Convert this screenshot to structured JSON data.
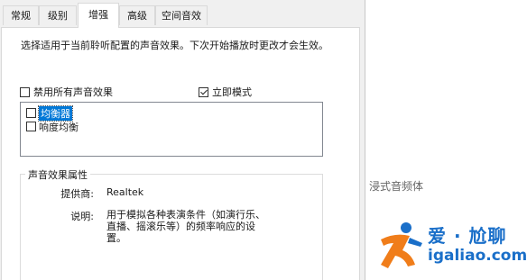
{
  "tabs": [
    {
      "label": "常规"
    },
    {
      "label": "级别"
    },
    {
      "label": "增强"
    },
    {
      "label": "高级"
    },
    {
      "label": "空间音效"
    }
  ],
  "active_tab": "增强",
  "description": "选择适用于当前聆听配置的声音效果。下次开始播放时更改才会生效。",
  "disable_all": {
    "label": "禁用所有声音效果",
    "checked": false
  },
  "immediate_mode": {
    "label": "立即模式",
    "checked": true
  },
  "effects": [
    {
      "label": "均衡器",
      "checked": false,
      "selected": true
    },
    {
      "label": "响度均衡",
      "checked": false,
      "selected": false
    }
  ],
  "properties": {
    "title": "声音效果属性",
    "provider_label": "提供商:",
    "provider_value": "Realtek",
    "desc_label": "说明:",
    "desc_value": "用于模拟各种表演条件（如演行乐、直播、摇滚乐等）的频率响应的设置。"
  },
  "side_text": "浸式音频体",
  "watermark": {
    "cn": "爱 · 尬聊",
    "url": "igaliao.com",
    "colors": {
      "orange": "#f07d1a",
      "blue": "#1a6fc9"
    }
  }
}
